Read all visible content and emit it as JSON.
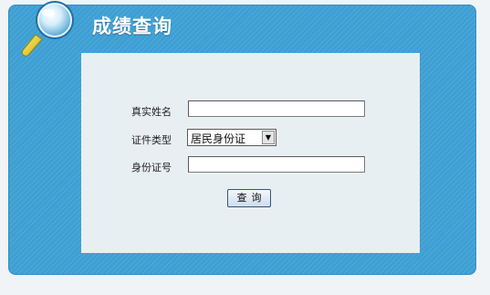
{
  "header": {
    "title": "成绩查询",
    "icon": "magnifier-icon"
  },
  "form": {
    "name_label": "真实姓名",
    "name_value": "",
    "id_type_label": "证件类型",
    "id_type_selected": "居民身份证",
    "id_number_label": "身份证号",
    "id_number_value": "",
    "submit_label": "查询"
  },
  "colors": {
    "panel_blue": "#3d9fd3",
    "form_background": "#e8eff3",
    "title_text": "#ffffff"
  }
}
